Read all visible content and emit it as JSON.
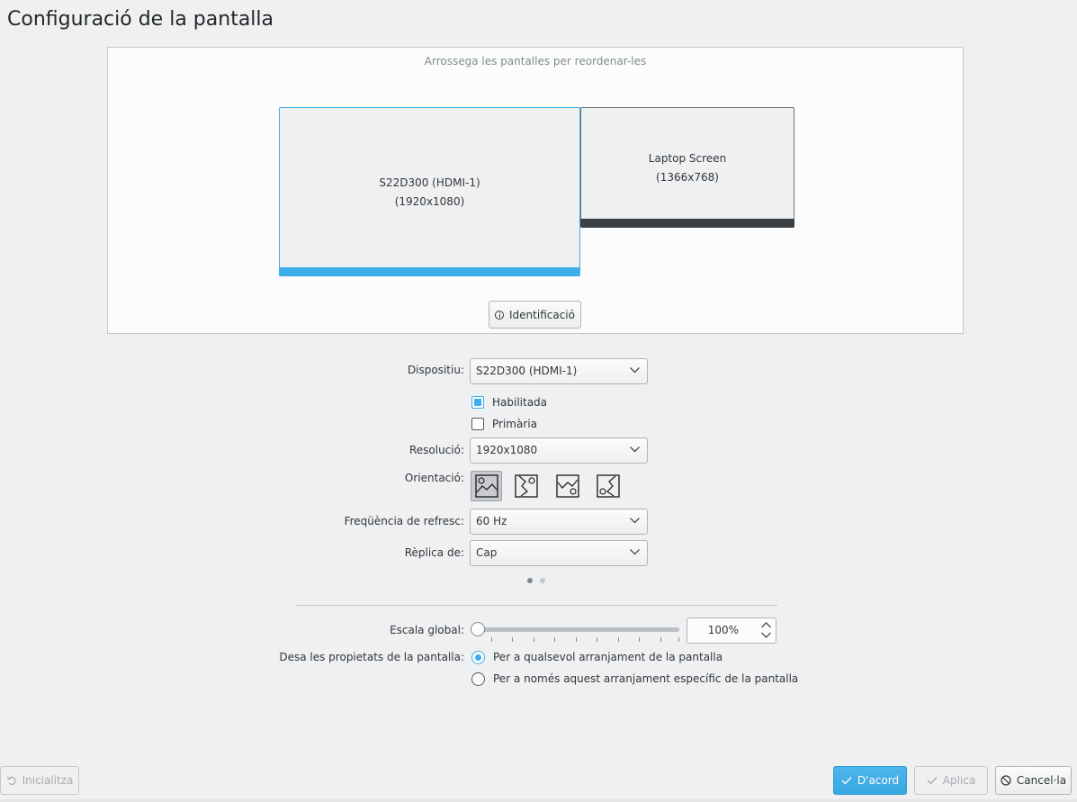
{
  "page": {
    "title": "Configuració de la pantalla"
  },
  "arrangement": {
    "hint": "Arrossega les pantalles per reordenar-les",
    "screens": [
      {
        "name": "S22D300 (HDMI-1)",
        "resolution": "(1920x1080)",
        "selected": true
      },
      {
        "name": "Laptop Screen",
        "resolution": "(1366x768)",
        "selected": false
      }
    ],
    "identify_label": "Identificació"
  },
  "form": {
    "device_label": "Dispositiu:",
    "device_value": "S22D300 (HDMI-1)",
    "enabled_label": "Habilitada",
    "enabled_checked": true,
    "primary_label": "Primària",
    "primary_checked": false,
    "resolution_label": "Resolució:",
    "resolution_value": "1920x1080",
    "orientation_label": "Orientació:",
    "orientation_options": [
      "landscape-icon",
      "portrait-icon",
      "inverted-landscape-icon",
      "inverted-portrait-icon"
    ],
    "orientation_selected": 0,
    "refresh_label": "Freqüència de refresc:",
    "refresh_value": "60 Hz",
    "replica_label": "Rèplica de:",
    "replica_value": "Cap",
    "pager": {
      "pages": 2,
      "current": 1
    }
  },
  "global": {
    "scale_label": "Escala global:",
    "scale_value": "100%",
    "scale_slider_fraction": 0.0,
    "save_label": "Desa les propietats de la pantalla:",
    "save_options": [
      "Per a qualsevol arranjament de la pantalla",
      "Per a només aquest arranjament específic de la pantalla"
    ],
    "save_selected": 0
  },
  "buttons": {
    "reset": "Inicialitza",
    "ok": "D'acord",
    "apply": "Aplica",
    "cancel": "Cancel·la"
  },
  "colors": {
    "accent": "#3daee9",
    "background": "#eff0f1",
    "text": "#31363b"
  }
}
